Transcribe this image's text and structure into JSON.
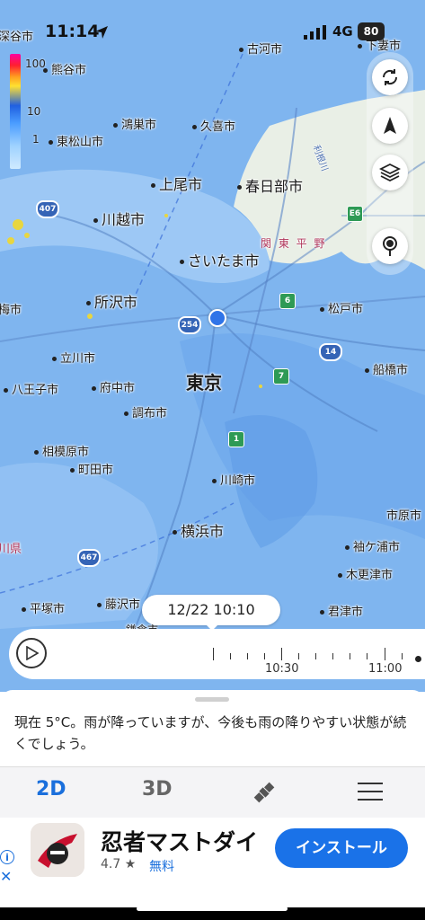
{
  "status": {
    "time": "11:14",
    "network": "4G",
    "battery": "80"
  },
  "map": {
    "legend": [
      "100",
      "10",
      "1"
    ],
    "places": {
      "tokyo": "東京",
      "saitama": "さいたま市",
      "yokohama": "横浜市",
      "kawasaki": "川崎市",
      "kumagaya": "熊谷市",
      "koga": "古河市",
      "shimotsuma": "下妻市",
      "konosu": "鴻巣市",
      "kuki": "久喜市",
      "higashimatsuyama": "東松山市",
      "ageo": "上尾市",
      "kasukabe": "春日部市",
      "kawagoe": "川越市",
      "tokorozawa": "所沢市",
      "ome": "梅市",
      "matsudo": "松戸市",
      "tachikawa": "立川市",
      "hachioji": "八王子市",
      "fuchu": "府中市",
      "funabashi": "船橋市",
      "chofu": "調布市",
      "sagamihara": "相模原市",
      "machida": "町田市",
      "ichihara": "市原市",
      "sodegaura": "袖ケ浦市",
      "kisarazu": "木更津市",
      "hiratsuka": "平塚市",
      "fujisawa": "藤沢市",
      "kimitsu": "君津市",
      "fukaya": "深谷市",
      "kanagawa": "川県",
      "kamakura": "鎌倉市",
      "kanto_plain": "関 東 平 野",
      "tone_river": "利根川"
    },
    "roads": {
      "r407": "407",
      "r254": "254",
      "r14": "14",
      "r467": "467",
      "e6": "E6",
      "n6": "6",
      "n7": "7",
      "n1": "1"
    }
  },
  "timeline": {
    "current": "12/22 10:10",
    "labels": [
      "10:30",
      "11:00"
    ]
  },
  "forecast": {
    "text": "現在 5°C。雨が降っていますが、今後も雨の降りやすい状態が続くでしょう。"
  },
  "tabs": {
    "tab2d": "2D",
    "tab3d": "3D"
  },
  "ad": {
    "title": "忍者マストダイ",
    "rating": "4.7 ★",
    "price": "無料",
    "install": "インストール",
    "info": "i",
    "close": "✕"
  },
  "colors": {
    "accent": "#1a72e8",
    "radar": "#7fb5ef",
    "land": "#e8efe8"
  }
}
